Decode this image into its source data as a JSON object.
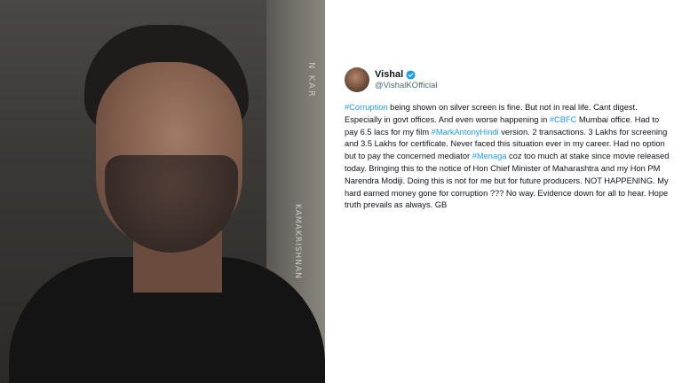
{
  "poster": {
    "text_lower": "KAMAKRISHNAN",
    "text_upper": "N KAR"
  },
  "tweet": {
    "display_name": "Vishal",
    "handle": "@VishalKOfficial",
    "colors": {
      "link": "#1d9bf0",
      "text": "#0f1419",
      "muted": "#536471",
      "verified": "#1d9bf0"
    },
    "segments": [
      {
        "text": "#Corruption",
        "tag": true
      },
      {
        "text": " being shown on silver screen is fine. But not in real life. Cant digest. Especially in govt offices. And even worse happening  in ",
        "tag": false
      },
      {
        "text": "#CBFC",
        "tag": true
      },
      {
        "text": " Mumbai office. Had to pay 6.5 lacs for my film ",
        "tag": false
      },
      {
        "text": "#MarkAntonyHindi",
        "tag": true
      },
      {
        "text": " version. 2 transactions. 3 Lakhs for screening and 3.5 Lakhs for certificate. Never faced this situation ever in my career. Had no option but to pay the concerned mediator ",
        "tag": false
      },
      {
        "text": "#Menaga",
        "tag": true
      },
      {
        "text": " coz too much at stake since movie released today. Bringing this to the notice of Hon Chief Minister of Maharashtra and my Hon PM Narendra Modiji. Doing this is not for me but for future producers. NOT HAPPENING. My hard earned money gone for corruption ??? No way. Evidence down for all to hear. Hope truth prevails as always. GB",
        "tag": false
      }
    ]
  }
}
